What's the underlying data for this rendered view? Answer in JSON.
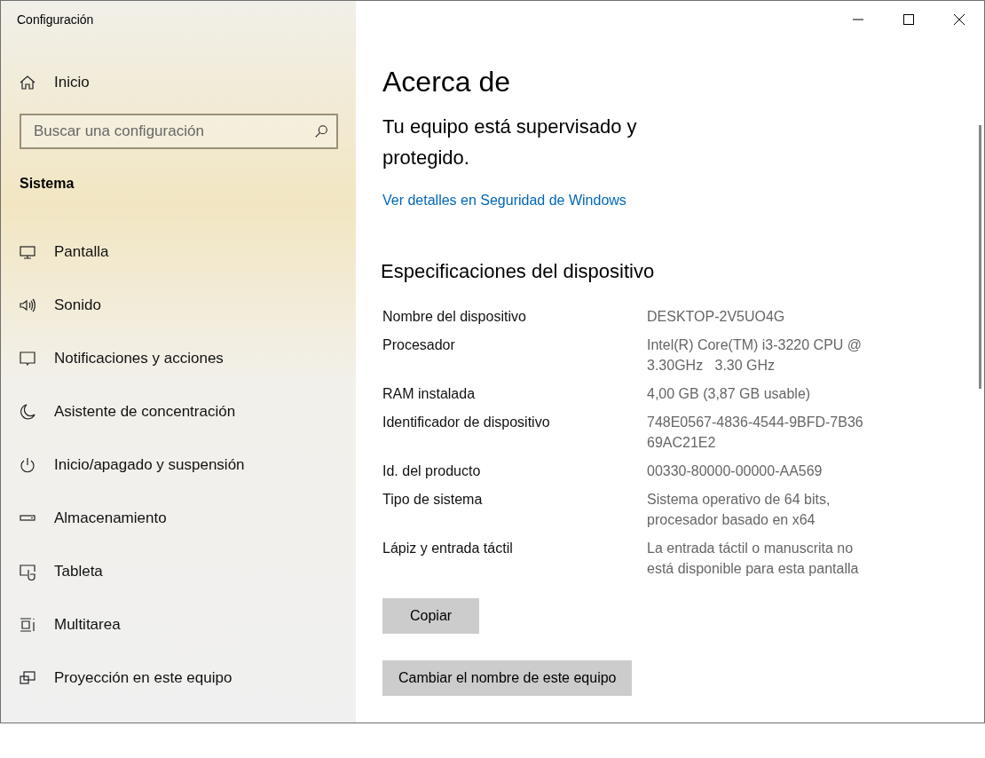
{
  "window": {
    "title": "Configuración"
  },
  "sidebar": {
    "home": {
      "label": "Inicio"
    },
    "search": {
      "placeholder": "Buscar una configuración"
    },
    "section": "Sistema",
    "items": [
      {
        "label": "Pantalla",
        "selected": false
      },
      {
        "label": "Sonido",
        "selected": false
      },
      {
        "label": "Notificaciones y acciones",
        "selected": false
      },
      {
        "label": "Asistente de concentración",
        "selected": false
      },
      {
        "label": "Inicio/apagado y suspensión",
        "selected": false
      },
      {
        "label": "Almacenamiento",
        "selected": false
      },
      {
        "label": "Tableta",
        "selected": false
      },
      {
        "label": "Multitarea",
        "selected": false
      },
      {
        "label": "Proyección en este equipo",
        "selected": false
      }
    ]
  },
  "main": {
    "title": "Acerca de",
    "status": "Tu equipo está supervisado y protegido.",
    "link": "Ver detalles en Seguridad de Windows",
    "specs_title": "Especificaciones del dispositivo",
    "specs": [
      {
        "label": "Nombre del dispositivo",
        "value": [
          "DESKTOP-2V5UO4G"
        ]
      },
      {
        "label": "Procesador",
        "value": [
          "Intel(R) Core(TM) i3-3220 CPU @",
          "3.30GHz   3.30 GHz"
        ]
      },
      {
        "label": "RAM instalada",
        "value": [
          "4,00 GB (3,87 GB usable)"
        ]
      },
      {
        "label": "Identificador de dispositivo",
        "value": [
          "748E0567-4836-4544-9BFD-7B36",
          "69AC21E2"
        ]
      },
      {
        "label": "Id. del producto",
        "value": [
          "00330-80000-00000-AA569"
        ]
      },
      {
        "label": "Tipo de sistema",
        "value": [
          "Sistema operativo de 64 bits,",
          "procesador basado en x64"
        ]
      },
      {
        "label": "Lápiz y entrada táctil",
        "value": [
          "La entrada táctil o manuscrita no",
          "está disponible para esta pantalla"
        ]
      }
    ],
    "buttons": [
      "Copiar",
      "Cambiar el nombre de este equipo"
    ]
  }
}
